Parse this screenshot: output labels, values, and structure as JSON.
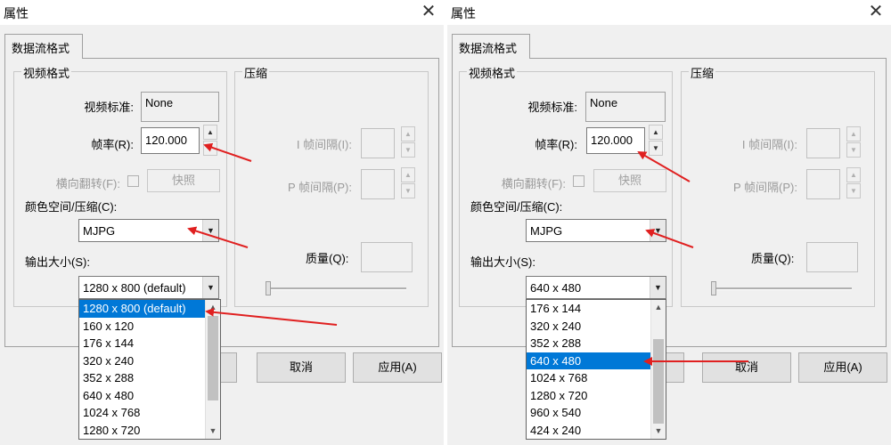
{
  "dialogs": [
    {
      "title": "属性",
      "close_icon": "close-icon",
      "tab_label": "数据流格式",
      "video_format": {
        "group_label": "视频格式",
        "standard_label": "视频标准:",
        "standard_value": "None",
        "framerate_label": "帧率(R):",
        "framerate_value": "120.000",
        "flip_label": "横向翻转(F):",
        "snapshot_label": "快照",
        "colorspace_label": "颜色空间/压缩(C):",
        "colorspace_value": "MJPG",
        "output_size_label": "输出大小(S):",
        "output_size_value": "1280 x 800  (default)"
      },
      "compression": {
        "group_label": "压缩",
        "i_frame_label": "I 帧间隔(I):",
        "p_frame_label": "P 帧间隔(P):",
        "quality_label": "质量(Q):"
      },
      "buttons": {
        "cancel": "取消",
        "apply": "应用(A)"
      },
      "dropdown": {
        "options": [
          "1280 x 800  (default)",
          "160 x 120",
          "176 x 144",
          "320 x 240",
          "352 x 288",
          "640 x 480",
          "1024 x 768",
          "1280 x 720"
        ],
        "selected_index": 0
      }
    },
    {
      "title": "属性",
      "close_icon": "close-icon",
      "tab_label": "数据流格式",
      "video_format": {
        "group_label": "视频格式",
        "standard_label": "视频标准:",
        "standard_value": "None",
        "framerate_label": "帧率(R):",
        "framerate_value": "120.000",
        "flip_label": "横向翻转(F):",
        "snapshot_label": "快照",
        "colorspace_label": "颜色空间/压缩(C):",
        "colorspace_value": "MJPG",
        "output_size_label": "输出大小(S):",
        "output_size_value": "640 x 480"
      },
      "compression": {
        "group_label": "压缩",
        "i_frame_label": "I 帧间隔(I):",
        "p_frame_label": "P 帧间隔(P):",
        "quality_label": "质量(Q):"
      },
      "buttons": {
        "cancel": "取消",
        "apply": "应用(A)"
      },
      "dropdown": {
        "options": [
          "176 x 144",
          "320 x 240",
          "352 x 288",
          "640 x 480",
          "1024 x 768",
          "1280 x 720",
          "960 x 540",
          "424 x 240"
        ],
        "selected_index": 3
      }
    }
  ],
  "colors": {
    "selection": "#0078d7",
    "annotation_arrow": "#e02020",
    "dialog_bg": "#f0f0f0"
  }
}
